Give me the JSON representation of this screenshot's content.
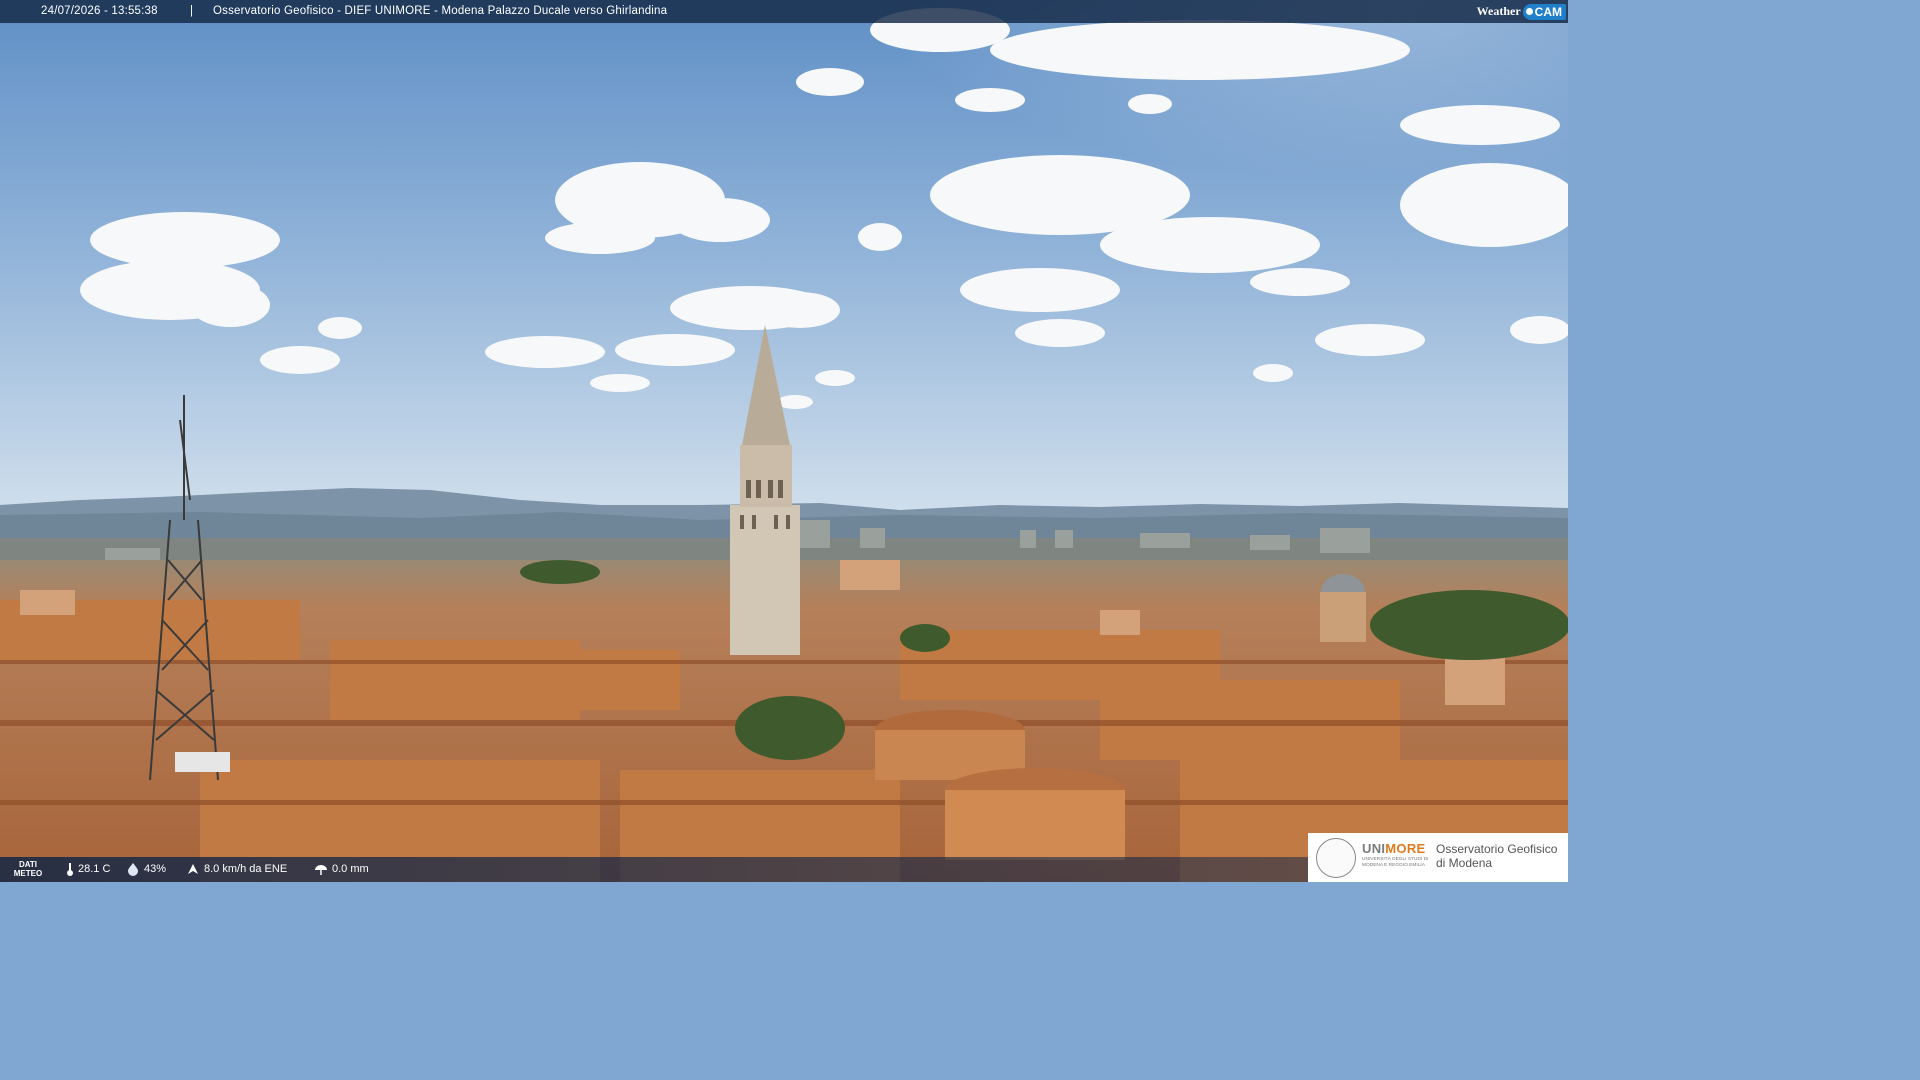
{
  "overlay": {
    "timestamp": "24/07/2026 - 13:55:38",
    "separator": "|",
    "location": "Osservatorio Geofisico - DIEF UNIMORE - Modena Palazzo Ducale verso Ghirlandina",
    "brand_weather": "Weather",
    "brand_cam": "CAM"
  },
  "meteo": {
    "label_line1": "DATI",
    "label_line2": "METEO",
    "temperature": "28.1 C",
    "humidity": "43%",
    "wind": "8.0 km/h da ENE",
    "rain": "0.0 mm"
  },
  "logo": {
    "uni": "UNI",
    "more": "MORE",
    "subtitle": "UNIVERSITÀ DEGLI STUDI DI MODENA E REGGIO EMILIA",
    "observatory": "Osservatorio Geofisico di Modena"
  },
  "colors": {
    "sky_top": "#5f8fc6",
    "sky_bottom": "#d6e3ee",
    "roof": "#b9713f",
    "overlay_bar": "#142846",
    "brand_blue": "#1f7fc9",
    "logo_orange": "#e07a1f"
  }
}
